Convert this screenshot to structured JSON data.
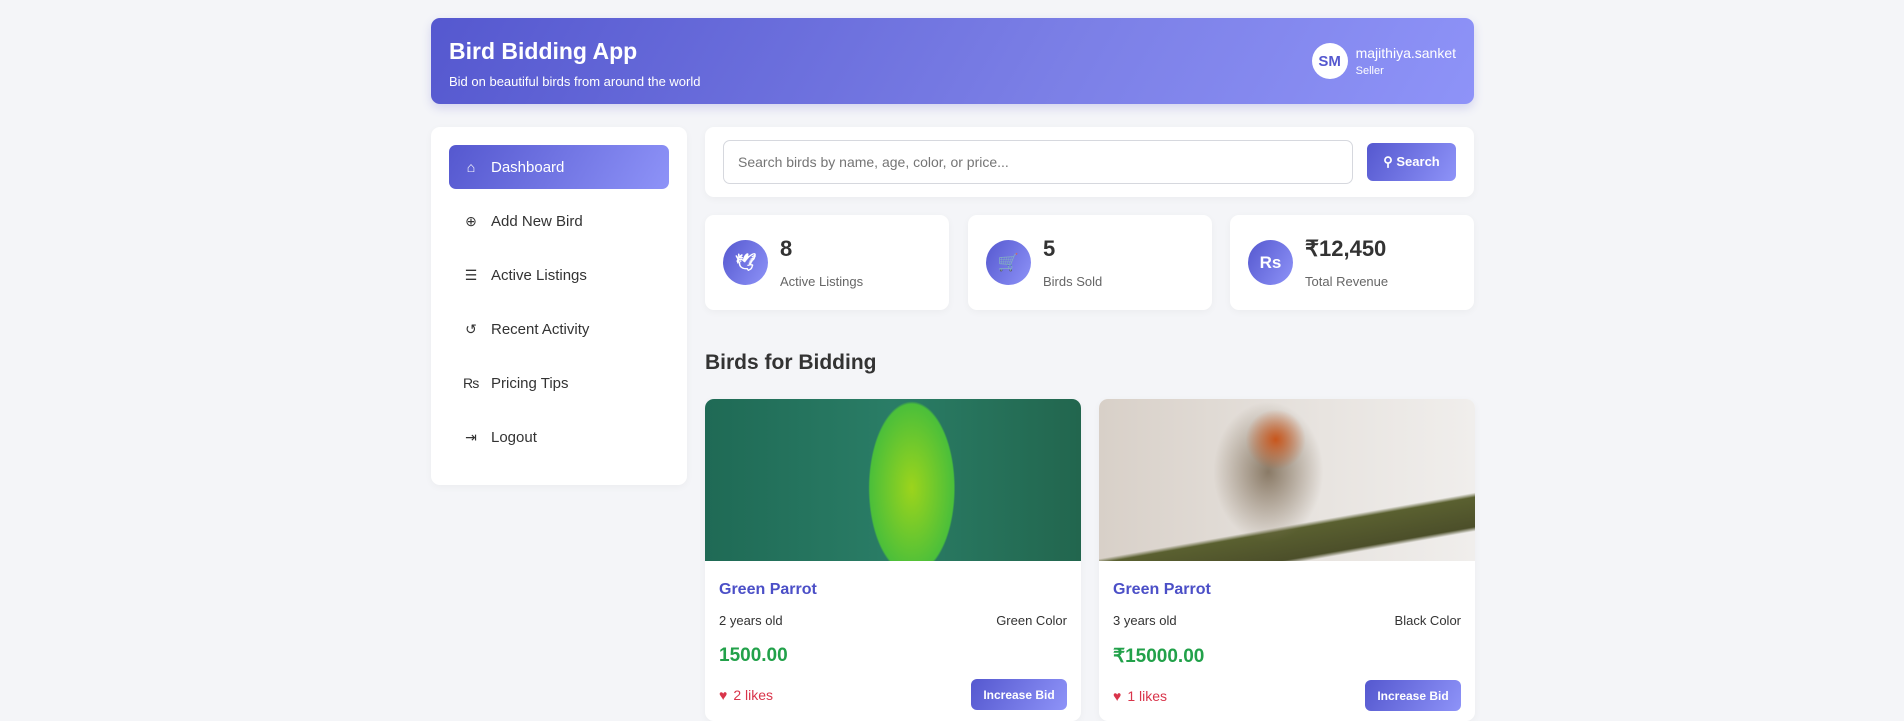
{
  "header": {
    "title": "Bird Bidding App",
    "subtitle": "Bid on beautiful birds from around the world",
    "user": {
      "initials": "SM",
      "name": "majithiya.sanket",
      "role": "Seller"
    }
  },
  "sidebar": {
    "items": [
      {
        "label": "Dashboard",
        "icon": "home-icon",
        "glyph": "⌂",
        "active": true
      },
      {
        "label": "Add New Bird",
        "icon": "plus-circle-icon",
        "glyph": "⊕"
      },
      {
        "label": "Active Listings",
        "icon": "list-icon",
        "glyph": "☰"
      },
      {
        "label": "Recent Activity",
        "icon": "history-icon",
        "glyph": "↺"
      },
      {
        "label": "Pricing Tips",
        "icon": "rupee-sign-icon",
        "glyph": "₨"
      },
      {
        "label": "Logout",
        "icon": "sign-out-icon",
        "glyph": "⇥"
      }
    ]
  },
  "search": {
    "placeholder": "Search birds by name, age, color, or price...",
    "value": "",
    "button": "Search",
    "icon": "search-icon"
  },
  "stats": [
    {
      "value": "8",
      "label": "Active Listings",
      "icon": "dove-icon",
      "glyph": "🕊"
    },
    {
      "value": "5",
      "label": "Birds Sold",
      "icon": "cart-icon",
      "glyph": "🛒"
    },
    {
      "value": "₹12,450",
      "label": "Total Revenue",
      "icon": "rupee-icon",
      "glyph": "Rs"
    }
  ],
  "section_title": "Birds for Bidding",
  "birds": [
    {
      "name": "Green Parrot",
      "age": "2 years old",
      "color": "Green Color",
      "price": "1500.00",
      "likes": "2 likes",
      "button": "Increase Bid"
    },
    {
      "name": "Green Parrot",
      "age": "3 years old",
      "color": "Black Color",
      "price": "₹15000.00",
      "likes": "1 likes",
      "button": "Increase Bid"
    }
  ],
  "colors": {
    "accent": "#5558cf",
    "price": "#22a14a",
    "likes": "#d9344a"
  }
}
